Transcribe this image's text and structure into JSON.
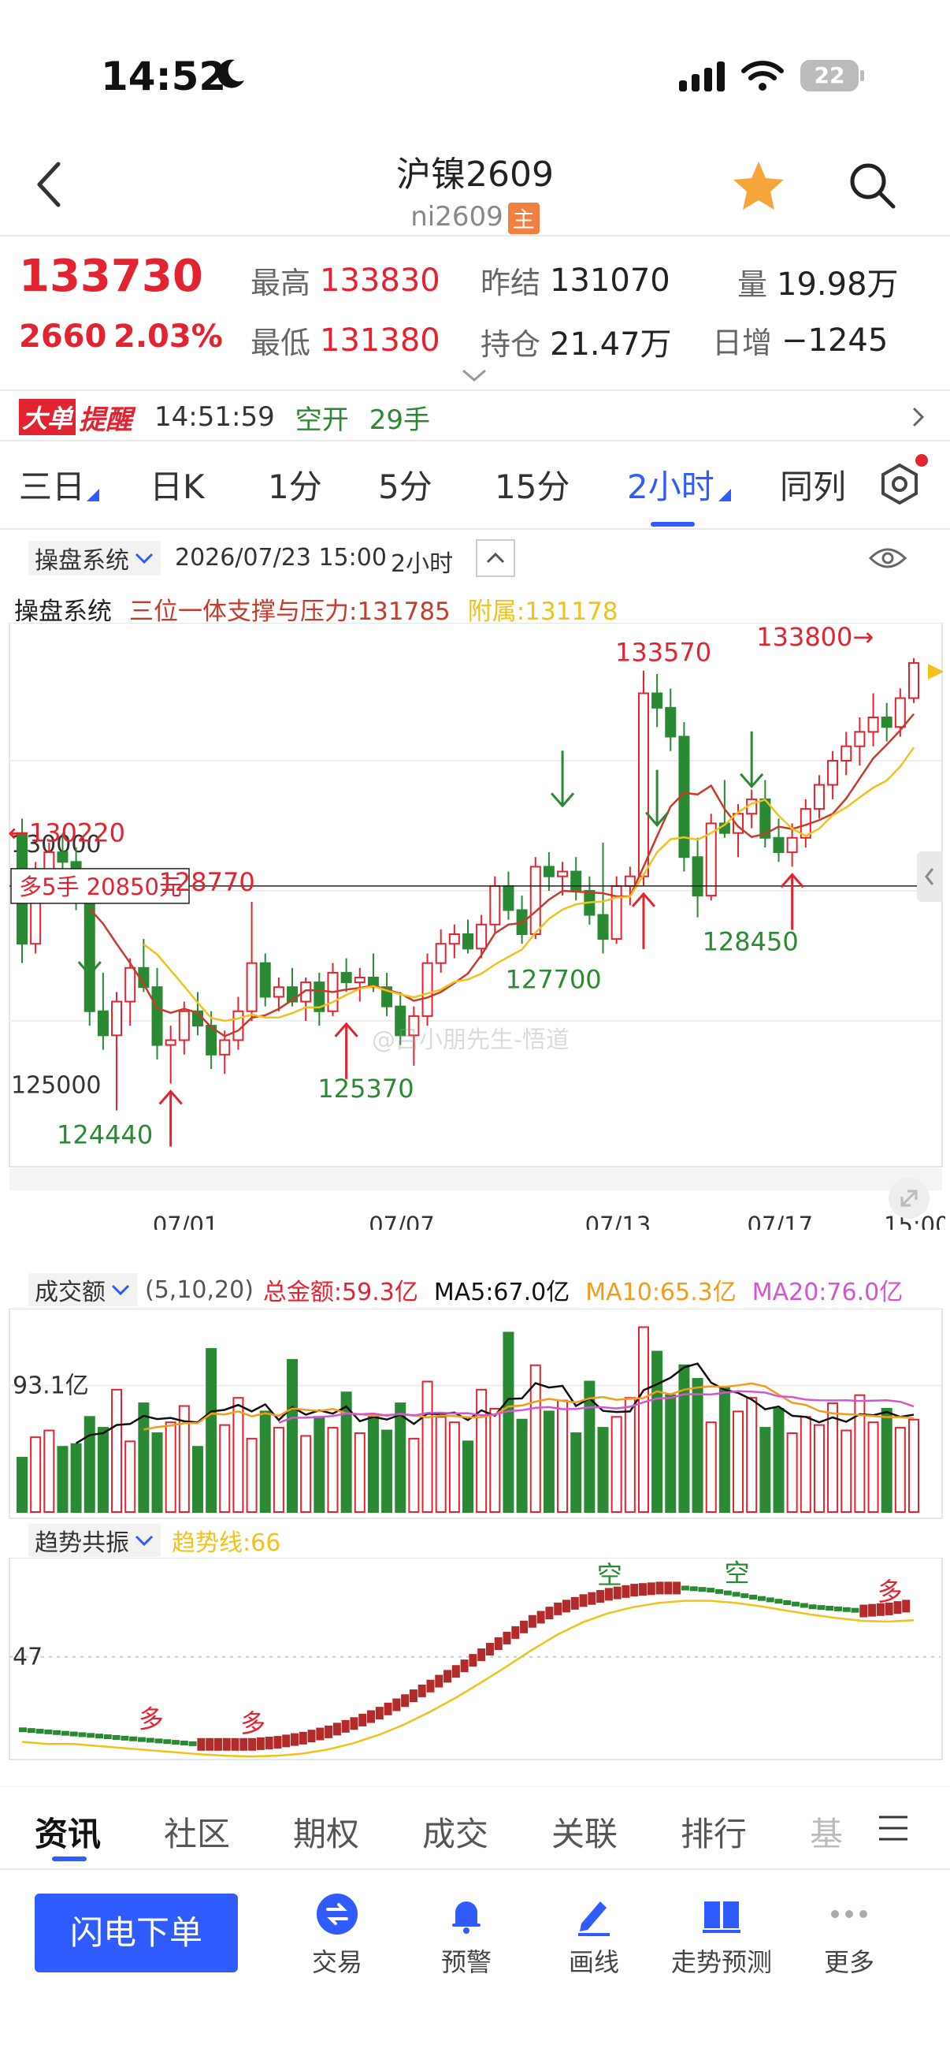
{
  "status": {
    "time": "14:52",
    "battery": "22"
  },
  "nav": {
    "title": "沪镍2609",
    "subtitle": "ni2609",
    "badge": "主"
  },
  "quote": {
    "price": "133730",
    "change": "2660",
    "change_pct": "2.03%",
    "high_label": "最高",
    "high": "133830",
    "low_label": "最低",
    "low": "131380",
    "prev_settle_label": "昨结",
    "prev_settle": "131070",
    "open_interest_label": "持仓",
    "open_interest": "21.47万",
    "volume_label": "量",
    "volume": "19.98万",
    "daily_inc_label": "日增",
    "daily_inc": "−1245"
  },
  "alert": {
    "badge_a": "大单",
    "badge_b": "提醒",
    "time": "14:51:59",
    "action": "空开",
    "qty": "29手"
  },
  "period_tabs": [
    "三日",
    "日K",
    "1分",
    "5分",
    "15分",
    "2小时",
    "同列"
  ],
  "active_tab": "2小时",
  "chart_header": {
    "system": "操盘系统",
    "datetime": "2026/07/23 15:00",
    "period": "2小时"
  },
  "indicator_line": {
    "name": "操盘系统",
    "support_label": "三位一体支撑与压力:131785",
    "attach_label": "附属:131178"
  },
  "chart_data": [
    {
      "type": "candlestick",
      "title": "",
      "x_ticks": [
        "07/01",
        "07/07",
        "07/13",
        "07/17",
        "15:00"
      ],
      "y_ticks": [
        "130000",
        "125000"
      ],
      "annotations": {
        "high_1": "133570",
        "high_2": "133800→",
        "left_mark": "←130220",
        "mid_high": "128770",
        "low_1": "124440",
        "low_2": "125370",
        "low_3": "127700",
        "low_4": "128450",
        "position_label": "多5手 20850元"
      },
      "ohlc": [
        [
          130200,
          130500,
          127500,
          127900
        ],
        [
          127900,
          129600,
          127700,
          129200
        ],
        [
          129200,
          130000,
          128900,
          129800
        ],
        [
          129800,
          130200,
          129300,
          129600
        ],
        [
          129600,
          129900,
          128600,
          128800
        ],
        [
          128800,
          129100,
          126200,
          126500
        ],
        [
          126500,
          127300,
          125700,
          126000
        ],
        [
          126000,
          126900,
          124440,
          126700
        ],
        [
          126700,
          127600,
          126200,
          127400
        ],
        [
          127400,
          128000,
          126900,
          127000
        ],
        [
          127000,
          127400,
          125500,
          125800
        ],
        [
          125800,
          126200,
          125000,
          125900
        ],
        [
          125900,
          126700,
          125600,
          126500
        ],
        [
          126500,
          126900,
          126000,
          126200
        ],
        [
          126200,
          126500,
          125300,
          125600
        ],
        [
          125600,
          126100,
          125200,
          125900
        ],
        [
          125900,
          126800,
          125700,
          126500
        ],
        [
          126500,
          128770,
          126300,
          127500
        ],
        [
          127500,
          127700,
          126600,
          126800
        ],
        [
          126800,
          127200,
          126500,
          127000
        ],
        [
          127000,
          127400,
          126600,
          126700
        ],
        [
          126700,
          127200,
          126300,
          127100
        ],
        [
          127100,
          127300,
          126200,
          126500
        ],
        [
          126500,
          127500,
          126400,
          127300
        ],
        [
          127300,
          127600,
          126900,
          127100
        ],
        [
          127100,
          127400,
          126700,
          127200
        ],
        [
          127200,
          127700,
          126900,
          127000
        ],
        [
          127000,
          127300,
          126400,
          126600
        ],
        [
          126600,
          126900,
          125800,
          126000
        ],
        [
          126000,
          126600,
          125370,
          126400
        ],
        [
          126400,
          127700,
          126200,
          127500
        ],
        [
          127500,
          128200,
          127300,
          127900
        ],
        [
          127900,
          128300,
          127600,
          128100
        ],
        [
          128100,
          128400,
          127700,
          127800
        ],
        [
          127800,
          128500,
          127600,
          128300
        ],
        [
          128300,
          129300,
          128100,
          129100
        ],
        [
          129100,
          129400,
          128400,
          128600
        ],
        [
          128600,
          128900,
          127900,
          128100
        ],
        [
          128100,
          129700,
          128000,
          129500
        ],
        [
          129500,
          129800,
          129000,
          129300
        ],
        [
          129300,
          129600,
          128900,
          129400
        ],
        [
          129400,
          129700,
          128800,
          129000
        ],
        [
          129000,
          129300,
          128300,
          128500
        ],
        [
          128500,
          130000,
          127700,
          128000
        ],
        [
          128000,
          129300,
          127900,
          129100
        ],
        [
          129100,
          129500,
          128700,
          129300
        ],
        [
          129300,
          133570,
          129100,
          133100
        ],
        [
          133100,
          133500,
          132400,
          132800
        ],
        [
          132800,
          133200,
          131900,
          132200
        ],
        [
          132200,
          132500,
          129400,
          129700
        ],
        [
          129700,
          130100,
          128450,
          128900
        ],
        [
          128900,
          130600,
          128800,
          130400
        ],
        [
          130400,
          131300,
          130100,
          130200
        ],
        [
          130200,
          130800,
          129700,
          130600
        ],
        [
          130600,
          131100,
          130300,
          130900
        ],
        [
          130900,
          131300,
          129900,
          130100
        ],
        [
          130100,
          130500,
          129600,
          129800
        ],
        [
          129800,
          130400,
          129500,
          130100
        ],
        [
          130100,
          130900,
          129900,
          130700
        ],
        [
          130700,
          131400,
          130500,
          131200
        ],
        [
          131200,
          131900,
          130900,
          131700
        ],
        [
          131700,
          132300,
          131400,
          132000
        ],
        [
          132000,
          132600,
          131600,
          132300
        ],
        [
          132300,
          133100,
          132000,
          132600
        ],
        [
          132600,
          132900,
          132100,
          132400
        ],
        [
          132400,
          133200,
          132200,
          133000
        ],
        [
          133000,
          133830,
          132900,
          133730
        ]
      ]
    },
    {
      "type": "bar",
      "title": "成交额",
      "params": "(5,10,20)",
      "total_label": "总金额:59.3亿",
      "ma5_label": "MA5:67.0亿",
      "ma10_label": "MA10:65.3亿",
      "ma20_label": "MA20:76.0亿",
      "y_tick": "93.1亿",
      "values": [
        40,
        55,
        60,
        48,
        50,
        70,
        62,
        90,
        52,
        80,
        58,
        66,
        78,
        48,
        120,
        64,
        84,
        54,
        74,
        62,
        112,
        56,
        70,
        62,
        88,
        58,
        72,
        60,
        80,
        54,
        96,
        70,
        66,
        52,
        90,
        76,
        132,
        68,
        108,
        74,
        82,
        58,
        96,
        62,
        70,
        84,
        136,
        118,
        86,
        108,
        98,
        66,
        92,
        74,
        84,
        62,
        76,
        58,
        70,
        64,
        80,
        60,
        86,
        66,
        76,
        62,
        68
      ]
    },
    {
      "type": "line",
      "title": "趋势共振",
      "trend_label": "趋势线:66",
      "y_tick": "47",
      "markers": [
        "多",
        "多",
        "空",
        "空",
        "多"
      ],
      "values": [
        12,
        11,
        10,
        9,
        8,
        7,
        6,
        5,
        5,
        5,
        6,
        8,
        11,
        15,
        20,
        26,
        33,
        40,
        48,
        56,
        64,
        70,
        74,
        77,
        79,
        80,
        80,
        79,
        77,
        75,
        73,
        71,
        70,
        69,
        70,
        72
      ]
    }
  ],
  "bottom_tabs": [
    "资讯",
    "社区",
    "期权",
    "成交",
    "关联",
    "排行",
    "基"
  ],
  "bottom_nav": {
    "order_button": "闪电下单",
    "items": [
      "交易",
      "预警",
      "画线",
      "走势预测",
      "更多"
    ]
  },
  "watermark": "@吕小朋先生-悟道",
  "colors": {
    "up": "#e3232f",
    "down": "#2a8a34",
    "accent": "#2f5bff",
    "ma_red": "#c83a2a",
    "ma_yellow": "#f2c21b",
    "ma_purple": "#d455d0"
  }
}
